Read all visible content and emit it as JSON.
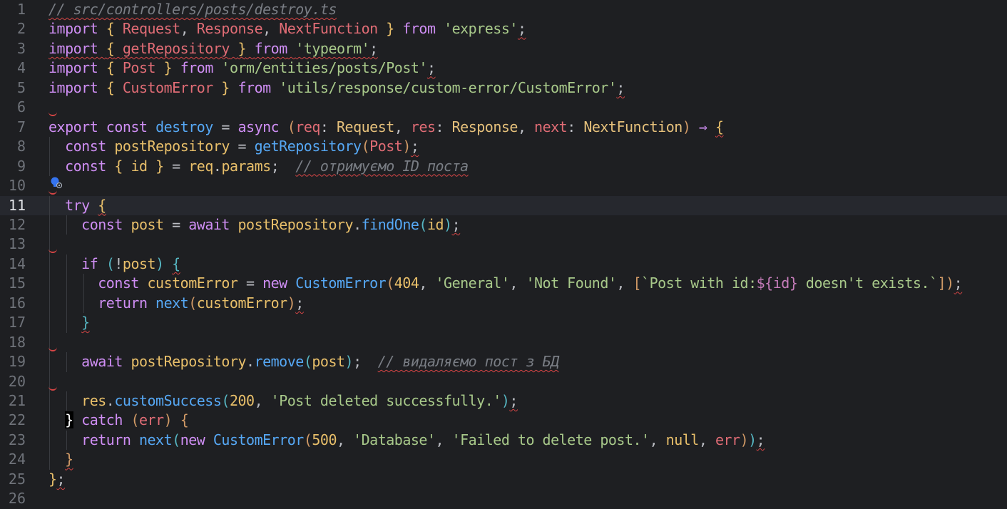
{
  "editor": {
    "file_comment": "// src/controllers/posts/destroy.ts",
    "lines": [
      {
        "n": "1"
      },
      {
        "n": "2"
      },
      {
        "n": "3"
      },
      {
        "n": "4"
      },
      {
        "n": "5"
      },
      {
        "n": "6"
      },
      {
        "n": "7"
      },
      {
        "n": "8"
      },
      {
        "n": "9"
      },
      {
        "n": "10"
      },
      {
        "n": "11"
      },
      {
        "n": "12"
      },
      {
        "n": "13"
      },
      {
        "n": "14"
      },
      {
        "n": "15"
      },
      {
        "n": "16"
      },
      {
        "n": "17"
      },
      {
        "n": "18"
      },
      {
        "n": "19"
      },
      {
        "n": "20"
      },
      {
        "n": "21"
      },
      {
        "n": "22"
      },
      {
        "n": "23"
      },
      {
        "n": "24"
      },
      {
        "n": "25"
      },
      {
        "n": "26"
      }
    ],
    "current_line": 11,
    "tokens": {
      "import": "import",
      "from": "from",
      "export": "export",
      "const": "const",
      "async": "async",
      "try": "try",
      "await": "await",
      "if": "if",
      "new": "new",
      "return": "return",
      "catch": "catch",
      "null": "null",
      "Request": "Request",
      "Response": "Response",
      "NextFunction": "NextFunction",
      "getRepository": "getRepository",
      "Post": "Post",
      "CustomError": "CustomError",
      "s_express": "'express'",
      "s_typeorm": "'typeorm'",
      "s_post_path": "'orm/entities/posts/Post'",
      "s_customerror_path": "'utils/response/custom-error/CustomError'",
      "destroy": "destroy",
      "req": "req",
      "res": "res",
      "next": "next",
      "postRepository": "postRepository",
      "id": "id",
      "params": "params",
      "comment_get_id": "// отримуємо ID поста",
      "post": "post",
      "findOne": "findOne",
      "customError": "customError",
      "n404": "404",
      "s_general": "'General'",
      "s_notfound": "'Not Found'",
      "tpl_start": "`Post with id:",
      "tpl_dollar": "${",
      "tpl_end": " doesn't exists.`",
      "remove": "remove",
      "comment_delete": "// видаляємо пост з БД",
      "customSuccess": "customSuccess",
      "n200": "200",
      "s_deleted": "'Post deleted successfully.'",
      "err": "err",
      "n500": "500",
      "s_database": "'Database'",
      "s_failed": "'Failed to delete post.'"
    }
  },
  "colors": {
    "background": "#1e1f22",
    "keyword": "#cf8ef4",
    "string": "#a8c98a",
    "number": "#2aacb8",
    "function": "#56a8f5",
    "error_underline": "#d64545"
  },
  "icons": {
    "intention": "lightbulb-icon"
  }
}
